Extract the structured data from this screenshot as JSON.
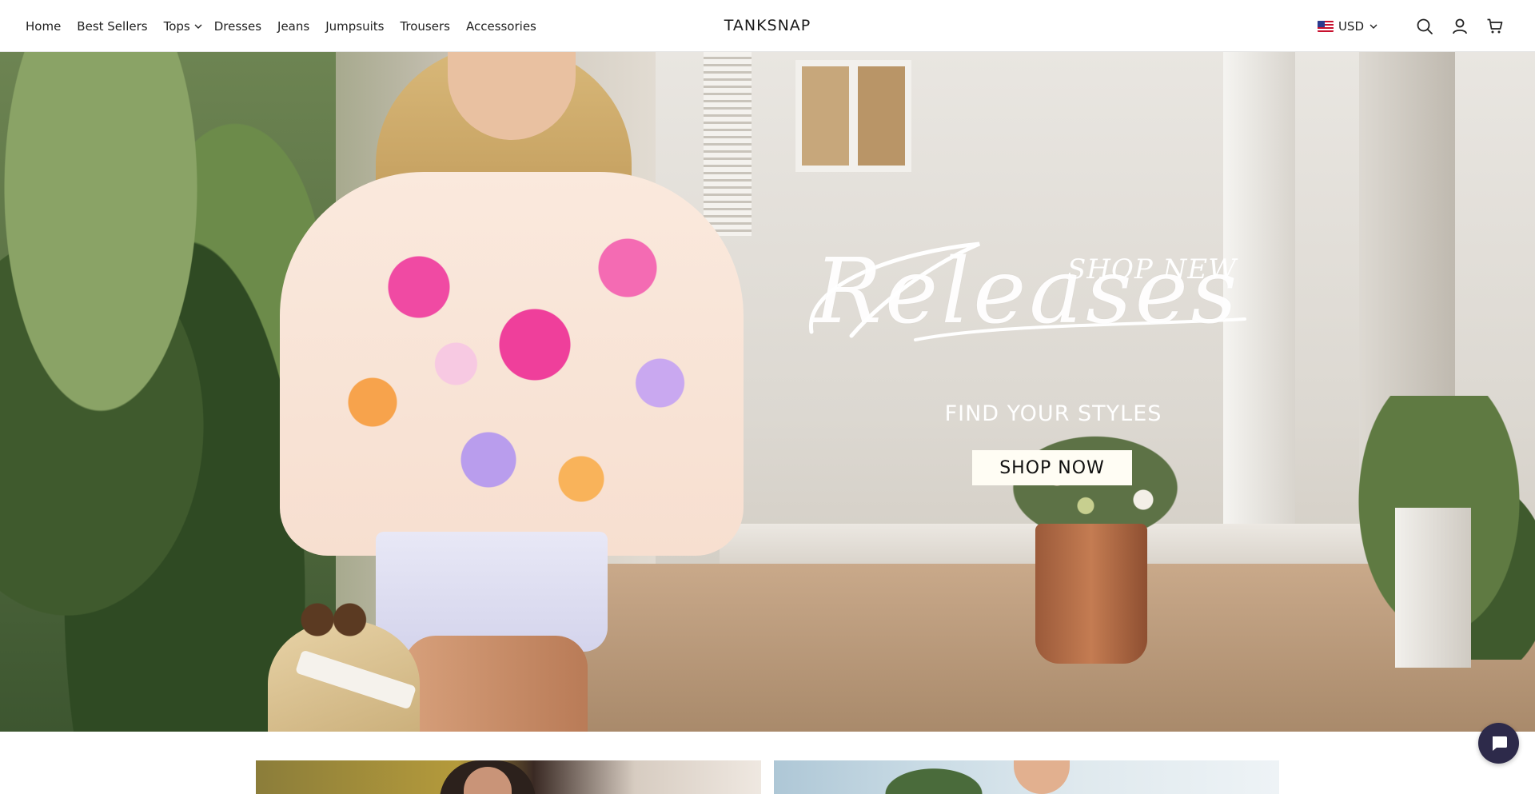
{
  "nav": {
    "items": [
      {
        "label": "Home"
      },
      {
        "label": "Best Sellers"
      },
      {
        "label": "Tops",
        "has_dropdown": true
      },
      {
        "label": "Dresses"
      },
      {
        "label": "Jeans"
      },
      {
        "label": "Jumpsuits"
      },
      {
        "label": "Trousers"
      },
      {
        "label": "Accessories"
      }
    ]
  },
  "brand": {
    "name": "TANKSNAP"
  },
  "tools": {
    "currency": "USD",
    "currency_flag": "us-flag-icon",
    "icons": [
      "search-icon",
      "account-icon",
      "cart-icon"
    ]
  },
  "hero": {
    "script_title": "Releases",
    "kicker": "SHOP NEW",
    "subtitle": "FIND YOUR STYLES",
    "cta_label": "SHOP NOW"
  },
  "chat": {
    "icon": "chat-icon"
  },
  "colors": {
    "cta_background": "#fffdf4",
    "chat_background": "#2d2a4a",
    "hero_text": "#ffffff"
  }
}
